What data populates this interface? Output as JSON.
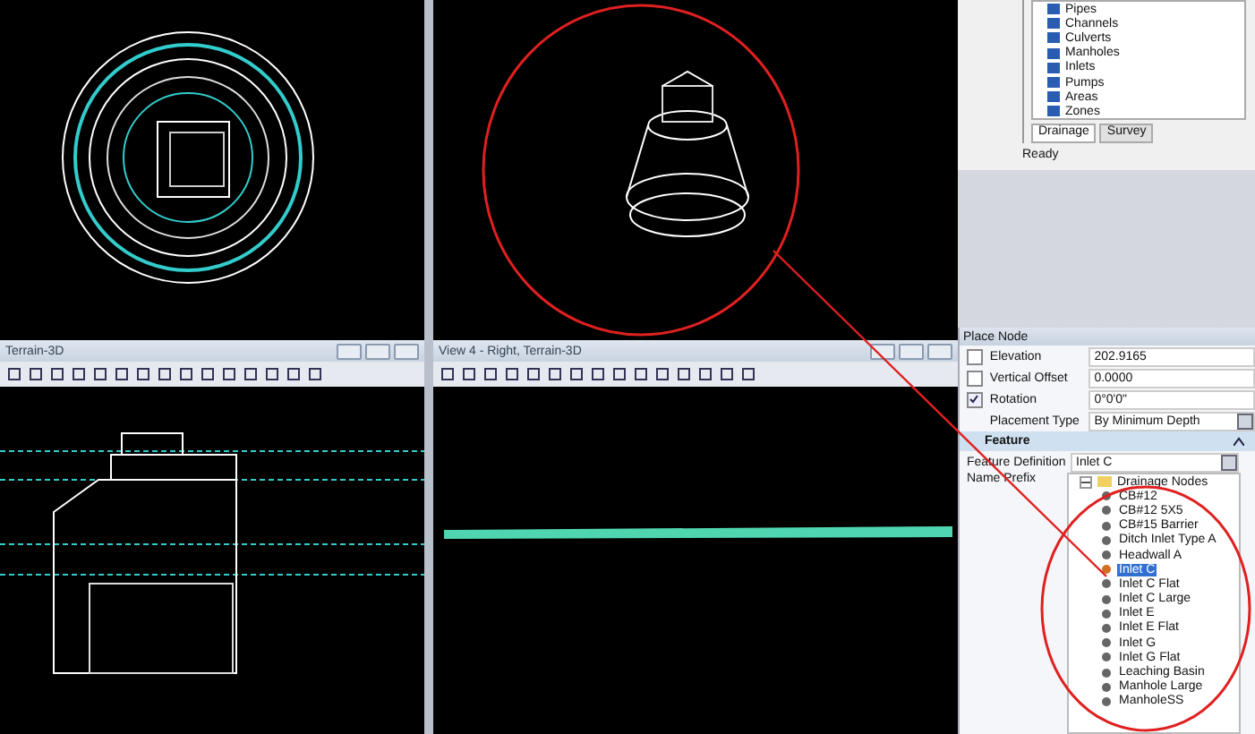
{
  "explorer": {
    "items": [
      {
        "label": "Pipes"
      },
      {
        "label": "Channels"
      },
      {
        "label": "Culverts"
      },
      {
        "label": "Manholes"
      },
      {
        "label": "Inlets"
      },
      {
        "label": "Pumps"
      },
      {
        "label": "Areas"
      },
      {
        "label": "Zones"
      }
    ],
    "tabs": [
      {
        "label": "Drainage",
        "selected": true
      },
      {
        "label": "Survey",
        "selected": false
      }
    ],
    "status": "Ready"
  },
  "viewports": [
    {
      "title": "Terrain-3D"
    },
    {
      "title": "View 4 - Right, Terrain-3D"
    }
  ],
  "place_node": {
    "title": "Place Node",
    "fields": [
      {
        "label": "Elevation",
        "checked": false,
        "value": "202.9165"
      },
      {
        "label": "Vertical Offset",
        "checked": false,
        "value": "0.0000"
      },
      {
        "label": "Rotation",
        "checked": true,
        "value": "0°0'0\""
      }
    ],
    "placement_type": {
      "label": "Placement Type",
      "value": "By Minimum Depth"
    },
    "section": "Feature",
    "feature_definition": {
      "label": "Feature Definition",
      "value": "Inlet C"
    },
    "name_prefix": {
      "label": "Name Prefix"
    },
    "tree": {
      "label": "Drainage Nodes",
      "expanded": true,
      "children": [
        {
          "label": "CB#12",
          "selected": false
        },
        {
          "label": "CB#12 5X5",
          "selected": false
        },
        {
          "label": "CB#15 Barrier",
          "selected": false
        },
        {
          "label": "Ditch Inlet Type A",
          "selected": false
        },
        {
          "label": "Headwall A",
          "selected": false
        },
        {
          "label": "Inlet C",
          "selected": true
        },
        {
          "label": "Inlet C Flat",
          "selected": false
        },
        {
          "label": "Inlet C Large",
          "selected": false
        },
        {
          "label": "Inlet E",
          "selected": false
        },
        {
          "label": "Inlet E Flat",
          "selected": false
        },
        {
          "label": "Inlet G",
          "selected": false
        },
        {
          "label": "Inlet G Flat",
          "selected": false
        },
        {
          "label": "Leaching Basin",
          "selected": false
        },
        {
          "label": "Manhole Large",
          "selected": false
        },
        {
          "label": "ManholeSS",
          "selected": false
        }
      ]
    }
  }
}
